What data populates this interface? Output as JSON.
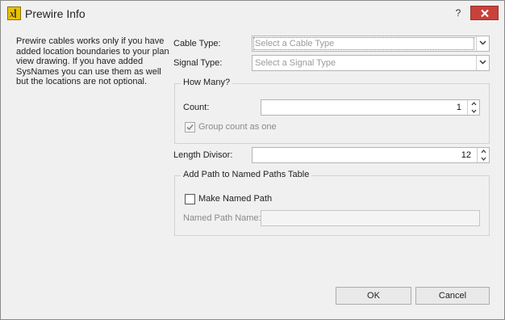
{
  "window": {
    "title": "Prewire Info",
    "help_label": "?"
  },
  "description": "Prewire cables works only if you have added location boundaries to your plan view drawing. If you have added SysNames you can use them as well but the locations are not optional.",
  "cable_type": {
    "label": "Cable Type:",
    "placeholder": "Select a Cable Type"
  },
  "signal_type": {
    "label": "Signal Type:",
    "placeholder": "Select a Signal Type"
  },
  "how_many": {
    "title": "How Many?",
    "count_label": "Count:",
    "count_value": "1",
    "group_count_label": "Group count as one",
    "group_count_checked": true,
    "group_count_enabled": false
  },
  "length_divisor": {
    "label": "Length Divisor:",
    "value": "12"
  },
  "named_path": {
    "title": "Add Path to Named Paths Table",
    "make_named_path_label": "Make Named Path",
    "make_named_path_checked": false,
    "name_label": "Named Path Name:",
    "name_value": ""
  },
  "buttons": {
    "ok": "OK",
    "cancel": "Cancel"
  },
  "colors": {
    "close_button": "#c7423a",
    "app_icon": "#e8c200"
  }
}
